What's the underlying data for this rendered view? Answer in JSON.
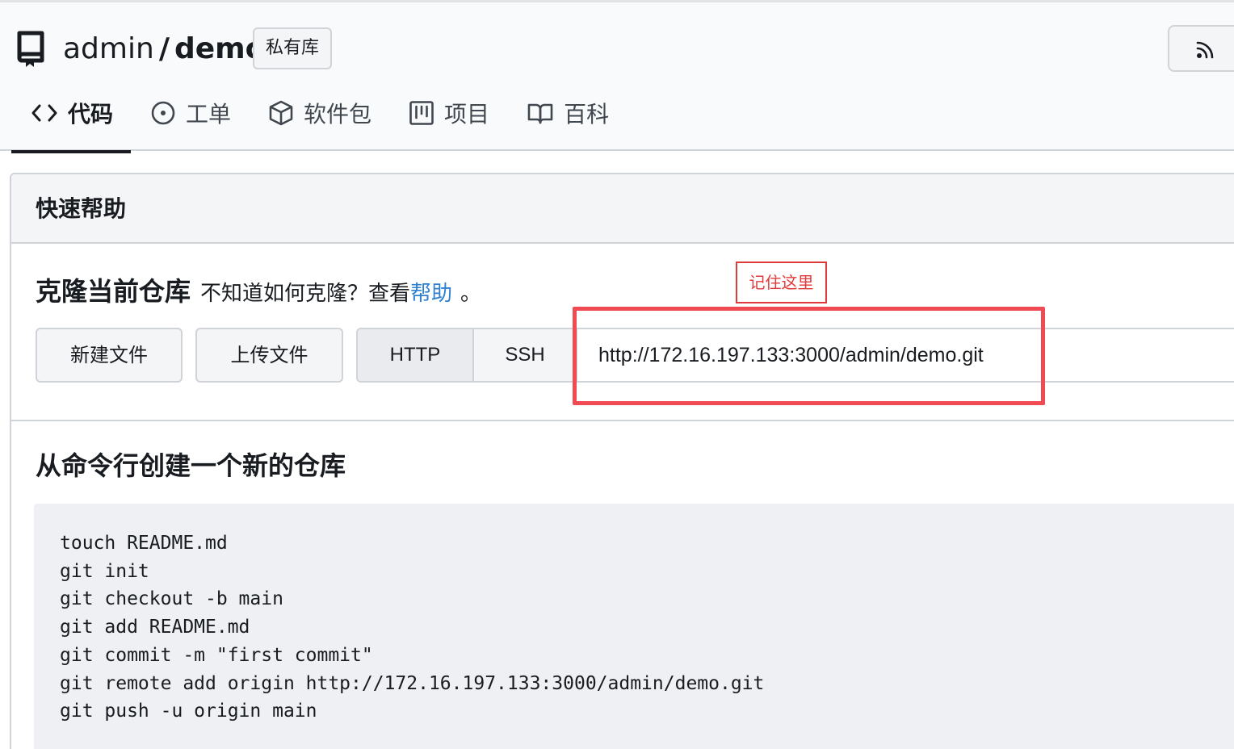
{
  "header": {
    "owner": "admin",
    "separator": "/",
    "repo": "demo",
    "private_badge": "私有库"
  },
  "tabs": [
    {
      "label": "代码",
      "icon": "code-icon",
      "active": true
    },
    {
      "label": "工单",
      "icon": "issue-icon",
      "active": false
    },
    {
      "label": "软件包",
      "icon": "package-icon",
      "active": false
    },
    {
      "label": "项目",
      "icon": "project-icon",
      "active": false
    },
    {
      "label": "百科",
      "icon": "book-icon",
      "active": false
    }
  ],
  "panel": {
    "title": "快速帮助"
  },
  "clone": {
    "heading": "克隆当前仓库",
    "question": "不知道如何克隆？查看",
    "help_link": "帮助",
    "period": "。",
    "new_file_button": "新建文件",
    "upload_file_button": "上传文件",
    "protocol_http": "HTTP",
    "protocol_ssh": "SSH",
    "url": "http://172.16.197.133:3000/admin/demo.git",
    "annotation": "记住这里"
  },
  "cli": {
    "heading": "从命令行创建一个新的仓库",
    "lines": [
      "touch README.md",
      "git init",
      "git checkout -b main",
      "git add README.md",
      "git commit -m \"first commit\"",
      "git remote add origin http://172.16.197.133:3000/admin/demo.git",
      "git push -u origin main"
    ]
  },
  "colors": {
    "accent_link": "#2f80d1",
    "annotation_red": "#f04a52"
  }
}
